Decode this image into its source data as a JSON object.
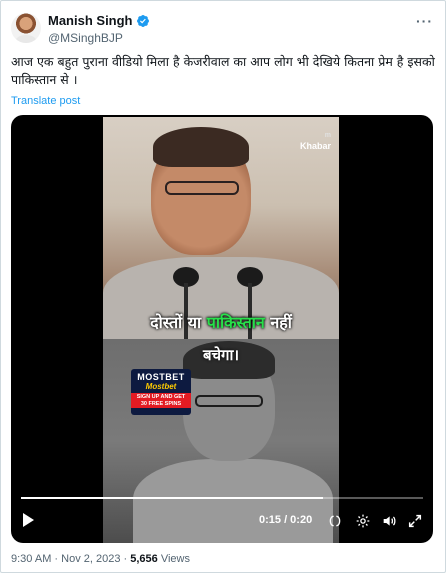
{
  "author": {
    "name": "Manish Singh",
    "handle": "@MSinghBJP",
    "verified_color": "#1d9bf0"
  },
  "more_label": "···",
  "tweet": {
    "text": "आज एक बहुत पुराना वीडियो मिला है केजरीवाल का आप लोग भी देखिये कितना प्रेम है इसको पाकिस्तान से ।",
    "translate_label": "Translate post"
  },
  "video": {
    "brand_top": "m",
    "brand_name": "Khabar",
    "subtitle_line1_part1": "दोस्तों या ",
    "subtitle_line1_highlight": "पाकिस्तान",
    "subtitle_line1_part2": " नहीं",
    "subtitle_line2": "बचेगा।",
    "ad": {
      "title": "MOSTBET",
      "subtitle": "Mostbet",
      "cta_line1": "SIGN UP AND GET",
      "cta_line2": "30 FREE SPINS"
    },
    "time_display": "0:15 / 0:20",
    "progress": 0.75,
    "icons": [
      "play-icon",
      "subtitles-icon",
      "volume-icon",
      "settings-icon",
      "fullscreen-icon"
    ]
  },
  "meta": {
    "time": "9:30 AM",
    "separator1": " · ",
    "date": "Nov 2, 2023",
    "separator2": " · ",
    "views_count": "5,656",
    "views_label": " Views"
  }
}
